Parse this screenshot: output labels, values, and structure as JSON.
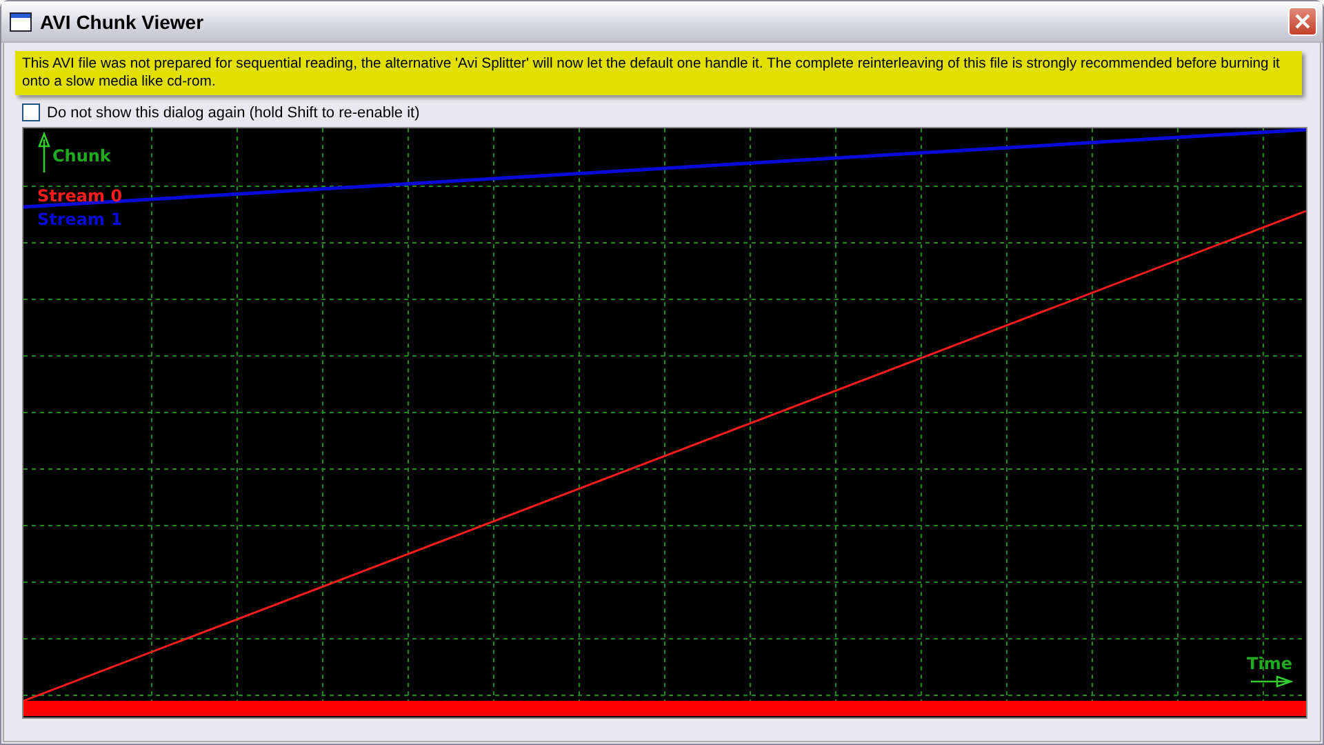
{
  "window": {
    "title": "AVI Chunk Viewer"
  },
  "warning": "This AVI file was not prepared for sequential reading, the alternative 'Avi Splitter' will now let the default one handle it.  The complete reinterleaving of this file is strongly recommended before burning it onto a slow media like cd-rom.",
  "checkbox": {
    "label": "Do not show this dialog again (hold Shift to re-enable it)",
    "checked": false
  },
  "chart": {
    "y_axis_label": "Chunk",
    "x_axis_label": "Time",
    "streams": [
      {
        "name": "Stream 0",
        "color": "#ff1c1c"
      },
      {
        "name": "Stream 1",
        "color": "#0a0ad8"
      }
    ]
  }
}
